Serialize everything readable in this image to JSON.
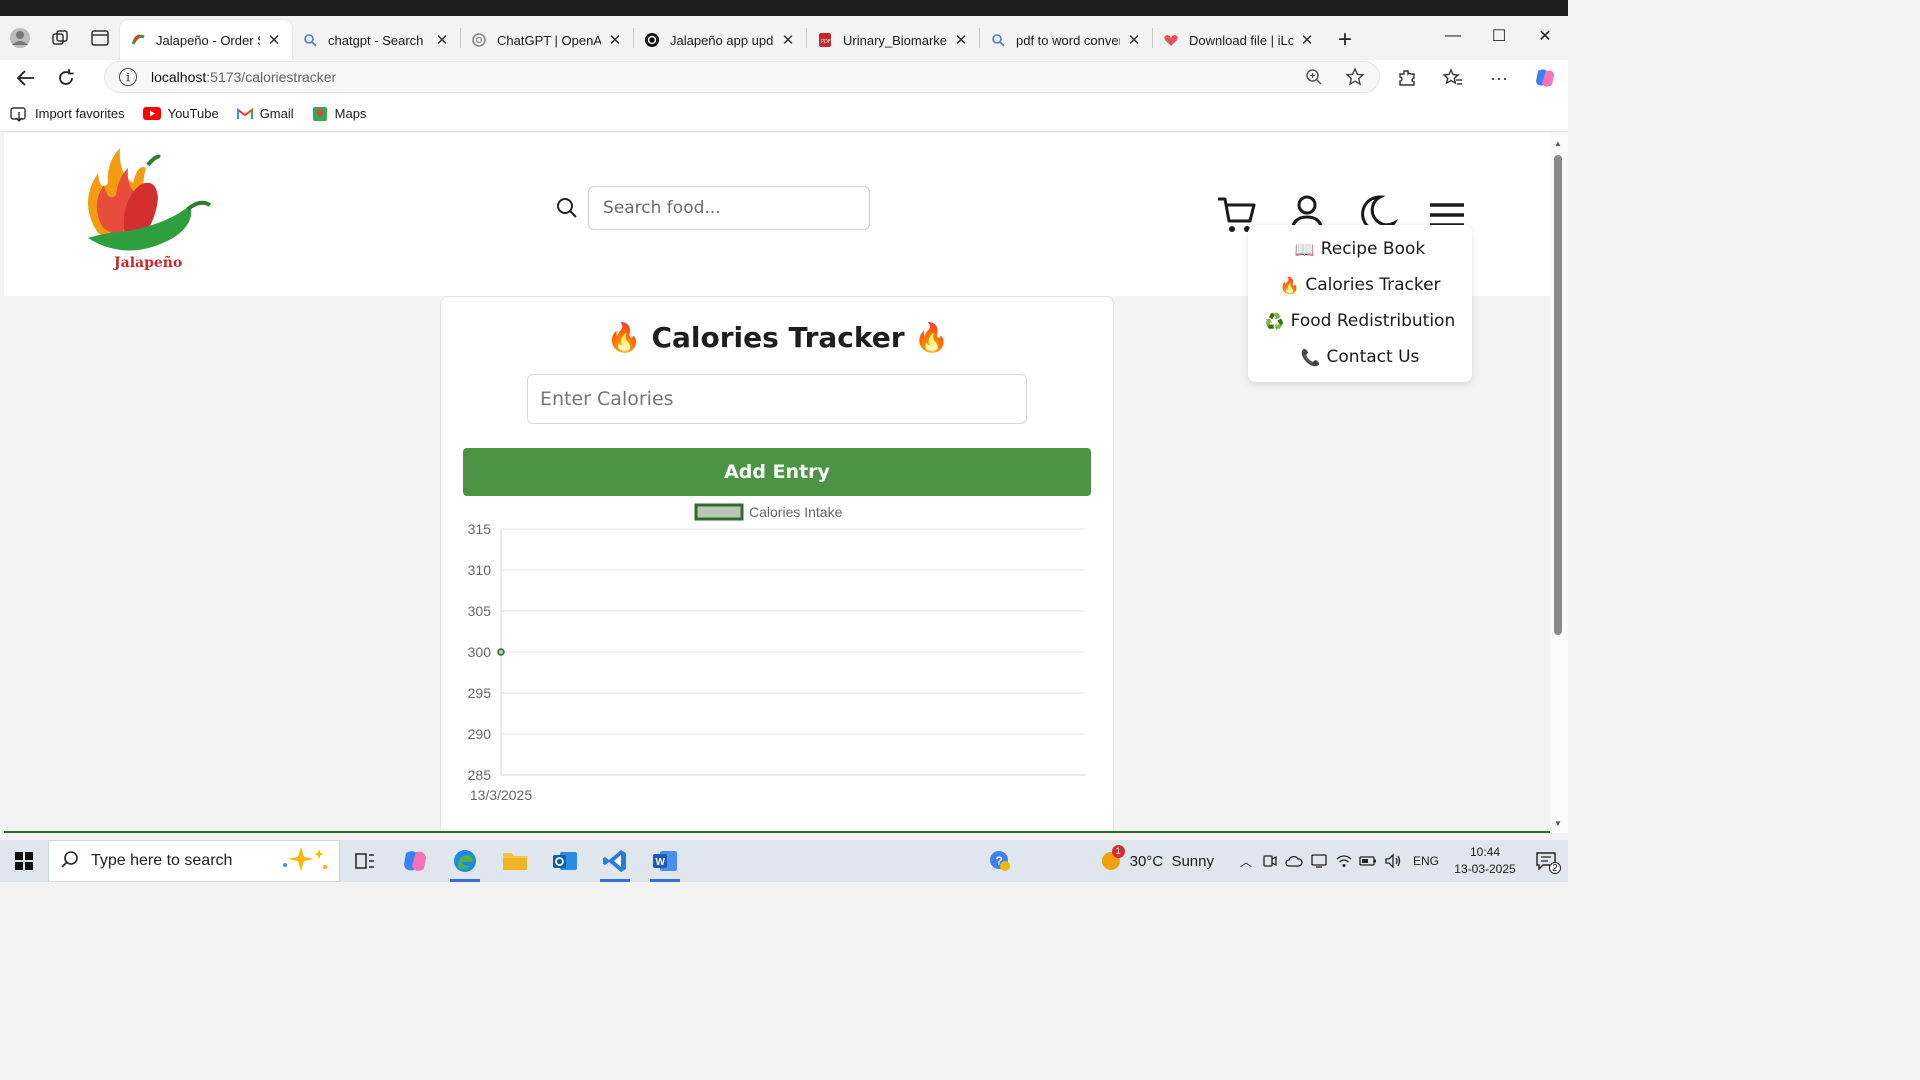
{
  "browser": {
    "tabs": [
      {
        "title": "Jalapeño - Order Sm",
        "active": true
      },
      {
        "title": "chatgpt - Search",
        "active": false
      },
      {
        "title": "ChatGPT | OpenAI",
        "active": false
      },
      {
        "title": "Jalapeño app update",
        "active": false
      },
      {
        "title": "Urinary_Biomarkers_",
        "active": false
      },
      {
        "title": "pdf to word converte",
        "active": false
      },
      {
        "title": "Download file | iLove",
        "active": false
      }
    ],
    "new_tab_label": "+",
    "url_host": "localhost",
    "url_path": ":5173/caloriestracker",
    "favorites": [
      {
        "label": "Import favorites",
        "icon": "import-favorites-icon"
      },
      {
        "label": "YouTube",
        "icon": "youtube-icon"
      },
      {
        "label": "Gmail",
        "icon": "gmail-icon"
      },
      {
        "label": "Maps",
        "icon": "maps-icon"
      }
    ]
  },
  "site": {
    "brand": "Jalapeño",
    "search_placeholder": "Search food...",
    "menu": [
      {
        "icon": "📖",
        "label": "Recipe Book"
      },
      {
        "icon": "🔥",
        "label": "Calories Tracker"
      },
      {
        "icon": "♻️",
        "label": "Food Redistribution"
      },
      {
        "icon": "📞",
        "label": "Contact Us"
      }
    ]
  },
  "tracker": {
    "title_icon": "🔥",
    "title": "Calories Tracker",
    "input_placeholder": "Enter Calories",
    "add_button": "Add Entry"
  },
  "chart_data": {
    "type": "line",
    "legend": [
      "Calories Intake"
    ],
    "legend_position": "top-center",
    "x": [
      "13/3/2025"
    ],
    "series": [
      {
        "name": "Calories Intake",
        "values": [
          300
        ]
      }
    ],
    "yticks": [
      315,
      310,
      305,
      300,
      295,
      290,
      285
    ],
    "ylim": [
      285,
      315
    ],
    "grid": true,
    "colors": {
      "line": "#2e6b2c",
      "fill": "#b7c9b6"
    }
  },
  "taskbar": {
    "search_placeholder": "Type here to search",
    "weather": "30°C  Sunny",
    "weather_badge": "1",
    "language": "ENG",
    "time": "10:44",
    "date": "13-03-2025",
    "notifications": "2"
  },
  "colors": {
    "accent_green": "#4a9444",
    "dark_green": "#2e6b2c"
  }
}
